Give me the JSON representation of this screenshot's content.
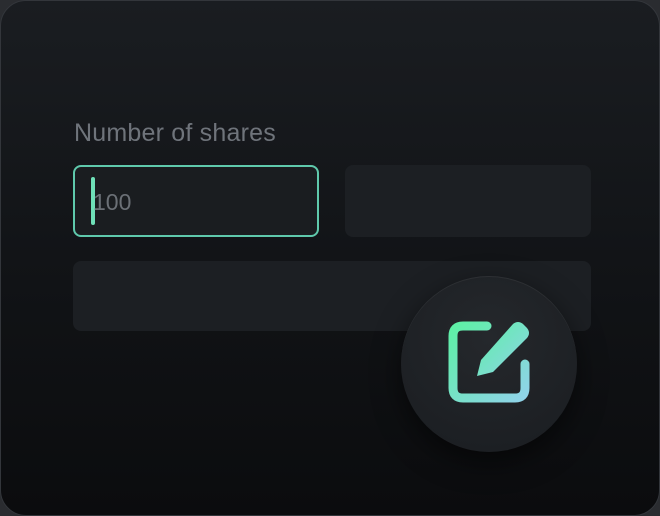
{
  "form": {
    "shares_label": "Number of shares",
    "shares_value": "100"
  },
  "icons": {
    "edit_button_icon": "edit-icon"
  },
  "colors": {
    "accent": "#5fc9ac",
    "caret": "#6fe0b8",
    "icon_gradient_start": "#5ef0a6",
    "icon_gradient_end": "#8fd3e8"
  }
}
